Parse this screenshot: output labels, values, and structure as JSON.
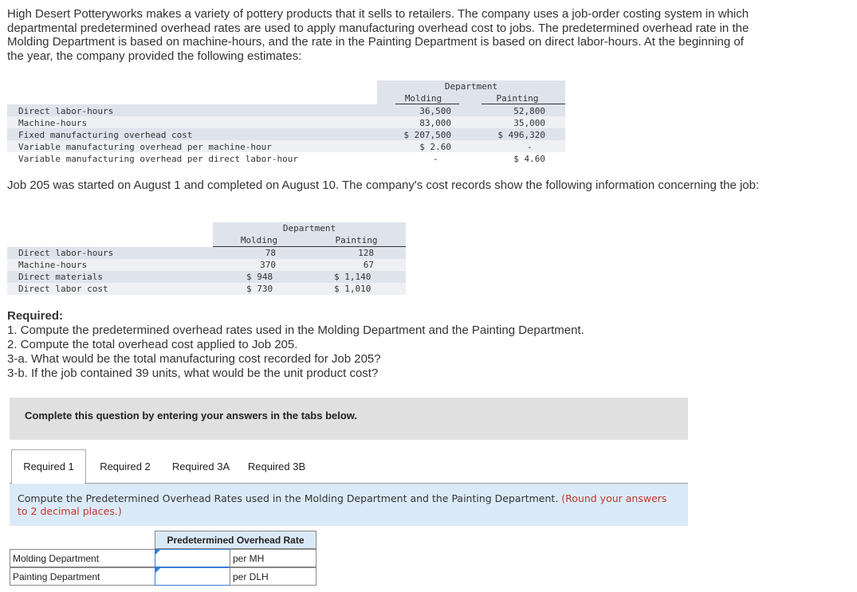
{
  "intro": "High Desert Potteryworks makes a variety of pottery products that it sells to retailers. The company uses a job-order costing system in which departmental predetermined overhead rates are used to apply manufacturing overhead cost to jobs. The predetermined overhead rate in the Molding Department is based on machine-hours, and the rate in the Painting Department is based on direct labor-hours. At the beginning of the year, the company provided the following estimates:",
  "estimates": {
    "group_header": "Department",
    "col1": "Molding",
    "col2": "Painting",
    "rows": [
      {
        "label": "Direct labor-hours",
        "molding": "36,500",
        "painting": "52,800"
      },
      {
        "label": "Machine-hours",
        "molding": "83,000",
        "painting": "35,000"
      },
      {
        "label": "Fixed manufacturing overhead cost",
        "molding": "$ 207,500",
        "painting": "$ 496,320"
      },
      {
        "label": "Variable manufacturing overhead per machine-hour",
        "molding": "$ 2.60",
        "painting": "-"
      },
      {
        "label": "Variable manufacturing overhead per direct labor-hour",
        "molding": "-",
        "painting": "$ 4.60"
      }
    ]
  },
  "job_intro": "Job 205 was started on August 1 and completed on August 10. The company's cost records show the following information concerning the job:",
  "job": {
    "group_header": "Department",
    "col1": "Molding",
    "col2": "Painting",
    "rows": [
      {
        "label": "Direct labor-hours",
        "molding": "78",
        "painting": "128"
      },
      {
        "label": "Machine-hours",
        "molding": "370",
        "painting": "67"
      },
      {
        "label": "Direct materials",
        "molding": "$ 948",
        "painting": "$ 1,140"
      },
      {
        "label": "Direct labor cost",
        "molding": "$ 730",
        "painting": "$ 1,010"
      }
    ]
  },
  "required": {
    "heading": "Required:",
    "items": [
      "1. Compute the predetermined overhead rates used in the Molding Department and the Painting Department.",
      "2. Compute the total overhead cost applied to Job 205.",
      "3-a. What would be the total manufacturing cost recorded for Job 205?",
      "3-b. If the job contained 39 units, what would be the unit product cost?"
    ]
  },
  "complete_prompt": "Complete this question by entering your answers in the tabs below.",
  "tabs": [
    "Required 1",
    "Required 2",
    "Required 3A",
    "Required 3B"
  ],
  "instruction": {
    "text": "Compute the Predetermined Overhead Rates used in the Molding Department and the Painting Department.",
    "note": "(Round your answers to 2 decimal places.)"
  },
  "answer_table": {
    "header": "Predetermined Overhead Rate",
    "rows": [
      {
        "label": "Molding Department",
        "value": "",
        "unit": "per MH"
      },
      {
        "label": "Painting Department",
        "value": "",
        "unit": "per DLH"
      }
    ]
  },
  "colors": {
    "band_blue": "#dfe3ec",
    "band_grey": "#eef0f4",
    "instruction_bg": "#dbeaf8",
    "note_red": "#c0392b",
    "input_border": "#3a7bd5"
  }
}
